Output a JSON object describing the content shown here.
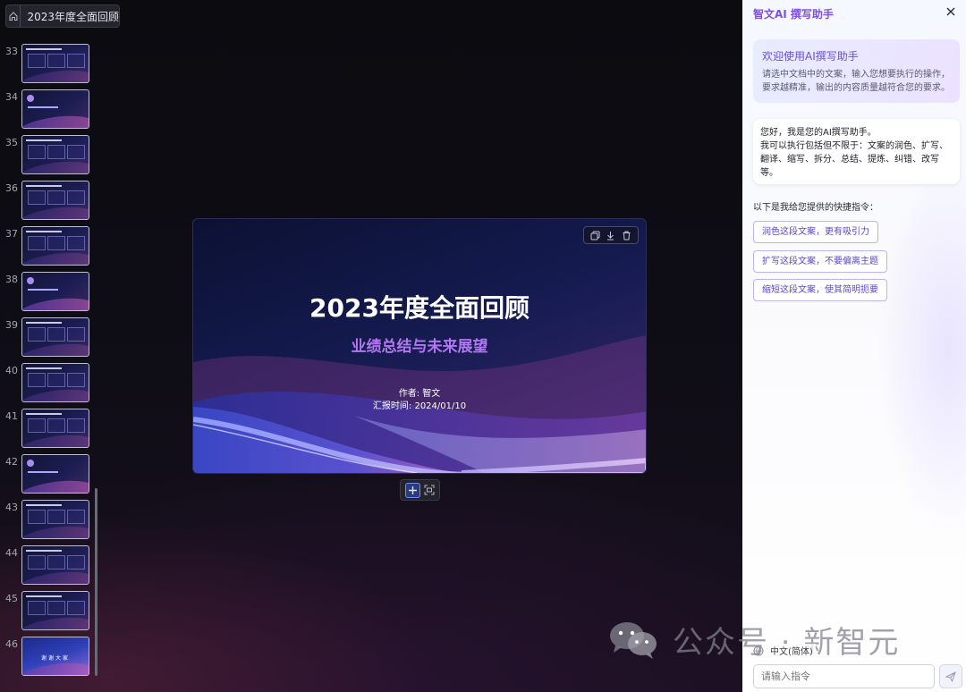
{
  "editor": {
    "doc_title": "2023年度全面回顾",
    "home_icon": "home-icon",
    "thumbnails": [
      {
        "num": "33",
        "kind": "content"
      },
      {
        "num": "34",
        "kind": "section"
      },
      {
        "num": "35",
        "kind": "content"
      },
      {
        "num": "36",
        "kind": "content"
      },
      {
        "num": "37",
        "kind": "content"
      },
      {
        "num": "38",
        "kind": "section"
      },
      {
        "num": "39",
        "kind": "content"
      },
      {
        "num": "40",
        "kind": "content"
      },
      {
        "num": "41",
        "kind": "content"
      },
      {
        "num": "42",
        "kind": "section"
      },
      {
        "num": "43",
        "kind": "content"
      },
      {
        "num": "44",
        "kind": "content"
      },
      {
        "num": "45",
        "kind": "content"
      },
      {
        "num": "46",
        "kind": "end"
      }
    ],
    "end_slide_text": "谢谢大家"
  },
  "slide": {
    "title": "2023年度全面回顾",
    "subtitle": "业绩总结与未来展望",
    "author": "作者: 智文",
    "date": "汇报时间: 2024/01/10",
    "tools": [
      "copy-icon",
      "download-icon",
      "delete-icon"
    ]
  },
  "zoom_bar": {
    "tools": [
      "add-slide-icon",
      "fit-screen-icon"
    ]
  },
  "assistant": {
    "title": "智文AI 撰写助手",
    "welcome_title": "欢迎使用AI撰写助手",
    "welcome_desc": "请选中文档中的文案，输入您想要执行的操作，要求越精准，输出的内容质量越符合您的要求。",
    "intro_line1": "您好，我是您的AI撰写助手。",
    "intro_line2": "我可以执行包括但不限于：文案的润色、扩写、翻译、缩写、拆分、总结、提炼、纠错、改写等。",
    "quick_title": "以下是我给您提供的快捷指令：",
    "quick_commands": [
      "润色这段文案，更有吸引力",
      "扩写这段文案，不要偏离主题",
      "缩短这段文案，使其简明扼要"
    ],
    "language": "中文(简体)",
    "input_placeholder": "请输入指令"
  },
  "watermark": {
    "text": "公众号 · 新智元"
  },
  "colors": {
    "accent": "#7b4fe0",
    "subtitle": "#b078f0",
    "chip_text": "#5a48c8"
  }
}
